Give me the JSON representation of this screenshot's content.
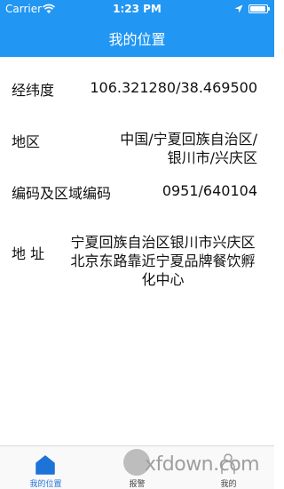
{
  "status_bar": {
    "carrier": "Carrier",
    "time": "1:23 PM",
    "battery_level": 0.95
  },
  "nav": {
    "title": "我的位置"
  },
  "info": {
    "coords_label": "经纬度",
    "coords_value": "106.321280/38.469500",
    "region_label": "地区",
    "region_value": "中国/宁夏回族自治区/银川市/兴庆区",
    "code_label": "编码及区域编码",
    "code_value": "0951/640104",
    "address_label": "地 址",
    "address_value": "宁夏回族自治区银川市兴庆区北京东路靠近宁夏品牌餐饮孵化中心"
  },
  "tabs": [
    {
      "label": "我的位置",
      "icon": "home-icon",
      "active": true
    },
    {
      "label": "报警",
      "icon": "alarm-icon",
      "active": false
    },
    {
      "label": "我的",
      "icon": "person-icon",
      "active": false
    }
  ],
  "watermark": "xfdown.com",
  "colors": {
    "brand": "#2196f3",
    "active_tab": "#1e73d8"
  }
}
